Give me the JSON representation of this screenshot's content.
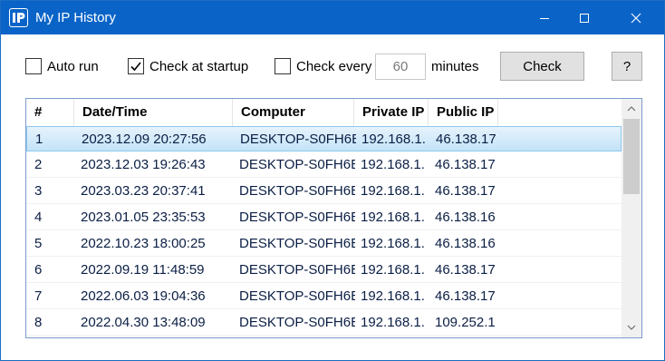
{
  "window": {
    "title": "My IP History",
    "icon": "ip-logo-icon"
  },
  "controls": {
    "auto_run_label": "Auto run",
    "auto_run_checked": false,
    "check_startup_label": "Check at startup",
    "check_startup_checked": true,
    "check_every_label": "Check every",
    "check_every_checked": false,
    "interval_value": "60",
    "minutes_label": "minutes",
    "check_button": "Check",
    "help_button": "?"
  },
  "table": {
    "columns": [
      "#",
      "Date/Time",
      "Computer",
      "Private IP",
      "Public IP"
    ],
    "rows": [
      {
        "num": "1",
        "datetime": "2023.12.09 20:27:56",
        "computer": "DESKTOP-S0FH6B",
        "private_ip": "192.168.1.",
        "public_ip": "46.138.17",
        "selected": true
      },
      {
        "num": "2",
        "datetime": "2023.12.03 19:26:43",
        "computer": "DESKTOP-S0FH6B",
        "private_ip": "192.168.1.",
        "public_ip": "46.138.17"
      },
      {
        "num": "3",
        "datetime": "2023.03.23 20:37:41",
        "computer": "DESKTOP-S0FH6B",
        "private_ip": "192.168.1.",
        "public_ip": "46.138.17"
      },
      {
        "num": "4",
        "datetime": "2023.01.05 23:35:53",
        "computer": "DESKTOP-S0FH6B",
        "private_ip": "192.168.1.",
        "public_ip": "46.138.16"
      },
      {
        "num": "5",
        "datetime": "2022.10.23 18:00:25",
        "computer": "DESKTOP-S0FH6B",
        "private_ip": "192.168.1.",
        "public_ip": "46.138.16"
      },
      {
        "num": "6",
        "datetime": "2022.09.19 11:48:59",
        "computer": "DESKTOP-S0FH6B",
        "private_ip": "192.168.1.",
        "public_ip": "46.138.17"
      },
      {
        "num": "7",
        "datetime": "2022.06.03 19:04:36",
        "computer": "DESKTOP-S0FH6B",
        "private_ip": "192.168.1.",
        "public_ip": "46.138.17"
      },
      {
        "num": "8",
        "datetime": "2022.04.30 13:48:09",
        "computer": "DESKTOP-S0FH6B",
        "private_ip": "192.168.1.",
        "public_ip": "109.252.1"
      }
    ]
  },
  "colors": {
    "titlebar": "#0a64c8",
    "selection": "#c4e3f8",
    "cell_text": "#0a1e44"
  }
}
